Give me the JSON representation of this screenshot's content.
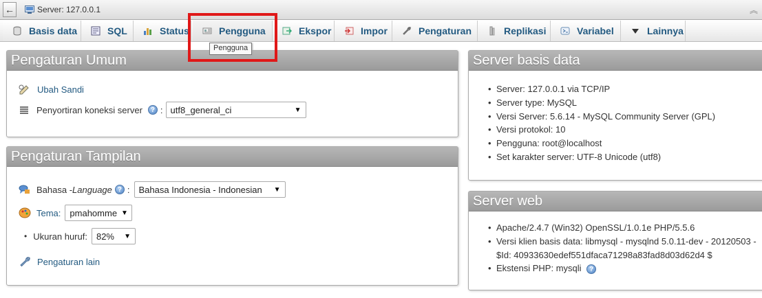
{
  "topbar": {
    "back": "←",
    "title": "Server: 127.0.0.1"
  },
  "tabs": [
    {
      "label": "Basis data",
      "icon": "database-icon"
    },
    {
      "label": "SQL",
      "icon": "sql-icon"
    },
    {
      "label": "Status",
      "icon": "status-chart-icon"
    },
    {
      "label": "Pengguna",
      "icon": "users-icon"
    },
    {
      "label": "Ekspor",
      "icon": "export-icon"
    },
    {
      "label": "Impor",
      "icon": "import-icon"
    },
    {
      "label": "Pengaturan",
      "icon": "wrench-icon"
    },
    {
      "label": "Replikasi",
      "icon": "replication-icon"
    },
    {
      "label": "Variabel",
      "icon": "variables-icon"
    },
    {
      "label": "Lainnya",
      "icon": "dropdown-triangle-icon"
    }
  ],
  "tooltip": "Pengguna",
  "general": {
    "title": "Pengaturan Umum",
    "change_password": "Ubah Sandi",
    "collation_label": "Penyortiran koneksi server",
    "collation_value": "utf8_general_ci"
  },
  "appearance": {
    "title": "Pengaturan Tampilan",
    "language_label": "Bahasa - ",
    "language_label_italic": "Language",
    "language_value": "Bahasa Indonesia - Indonesian",
    "theme_label": "Tema:",
    "theme_value": "pmahomme",
    "font_label": "Ukuran huruf:",
    "font_value": "82%",
    "more_settings": "Pengaturan lain"
  },
  "db_server": {
    "title": "Server basis data",
    "items": [
      "Server: 127.0.0.1 via TCP/IP",
      "Server type: MySQL",
      "Versi Server: 5.6.14 - MySQL Community Server (GPL)",
      "Versi protokol: 10",
      "Pengguna: root@localhost",
      "Set karakter server: UTF-8 Unicode (utf8)"
    ]
  },
  "web_server": {
    "title": "Server web",
    "items": [
      "Apache/2.4.7 (Win32) OpenSSL/1.0.1e PHP/5.5.6",
      "Versi klien basis data: libmysql - mysqlnd 5.0.11-dev - 20120503 -",
      "$Id: 40933630edef551dfaca71298a83fad8d03d62d4 $",
      "Ekstensi PHP: mysqli"
    ]
  }
}
